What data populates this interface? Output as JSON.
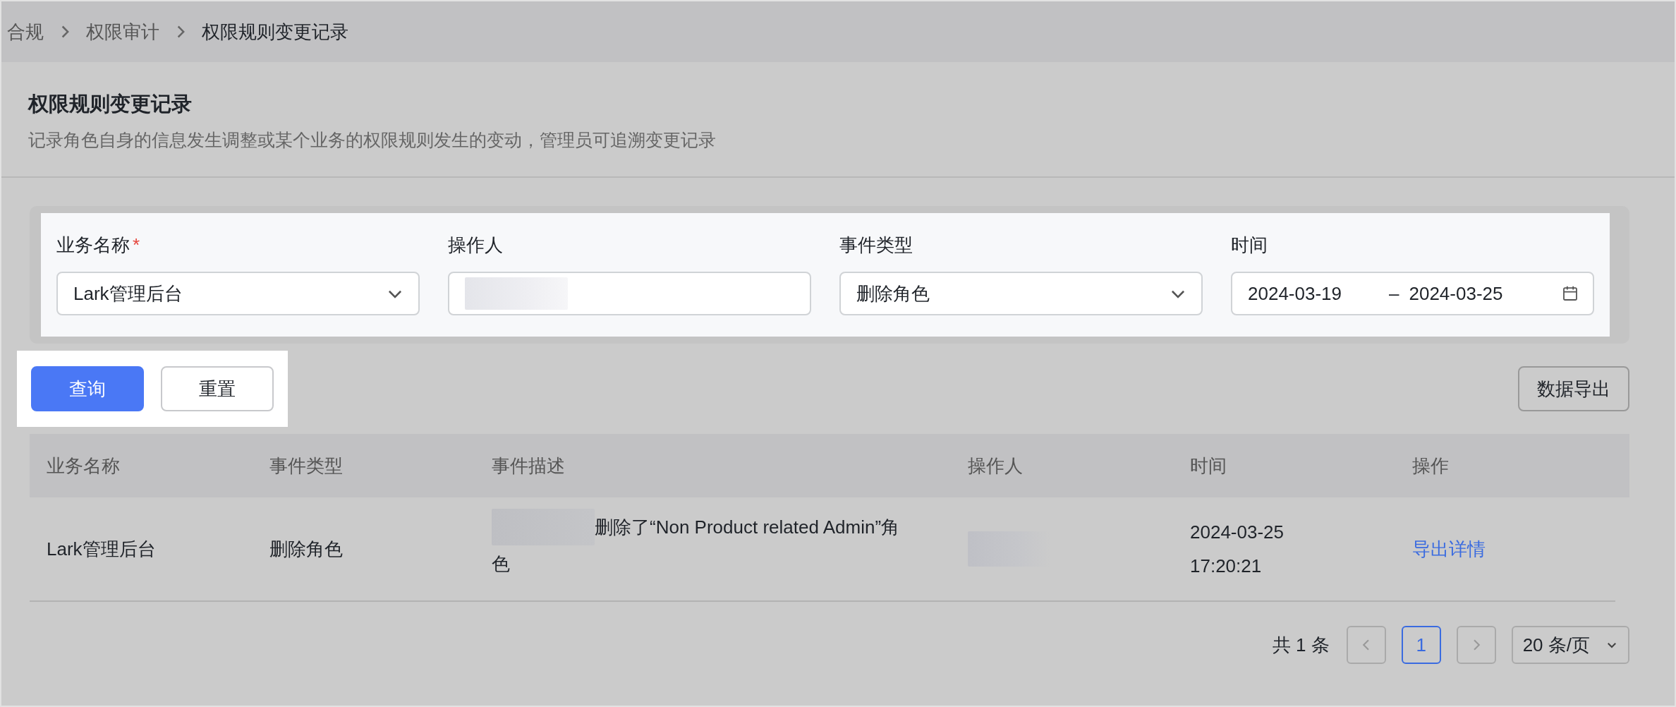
{
  "breadcrumb": [
    {
      "label": "合规",
      "current": false
    },
    {
      "label": "权限审计",
      "current": false
    },
    {
      "label": "权限规则变更记录",
      "current": true
    }
  ],
  "page": {
    "title": "权限规则变更记录",
    "description": "记录角色自身的信息发生调整或某个业务的权限规则发生的变动，管理员可追溯变更记录"
  },
  "filters": {
    "highlighted": true,
    "fields": [
      {
        "kind": "select",
        "label": "业务名称",
        "required_mark": "*",
        "value": "Lark管理后台"
      },
      {
        "kind": "blurred",
        "label": "操作人"
      },
      {
        "kind": "select",
        "label": "事件类型",
        "value": "删除角色"
      },
      {
        "kind": "daterange",
        "label": "时间",
        "start": "2024-03-19",
        "separator": "–",
        "end": "2024-03-25"
      }
    ]
  },
  "actions": {
    "highlighted": true,
    "buttons": [
      {
        "label": "查询",
        "primary": true
      },
      {
        "label": "重置",
        "primary": false
      }
    ]
  },
  "export_button": "数据导出",
  "table": {
    "columns": [
      "业务名称",
      "事件类型",
      "事件描述",
      "操作人",
      "时间",
      "操作"
    ],
    "rows": [
      {
        "business": "Lark管理后台",
        "event_type": "删除角色",
        "description": "删除了“Non Product related Admin”角色",
        "time": [
          "2024-03-25",
          "17:20:21"
        ],
        "action": "导出详情"
      }
    ]
  },
  "pagination": {
    "total": "共 1 条",
    "pages": [
      {
        "label": "1",
        "selected": true
      }
    ],
    "page_size": "20 条/页"
  }
}
